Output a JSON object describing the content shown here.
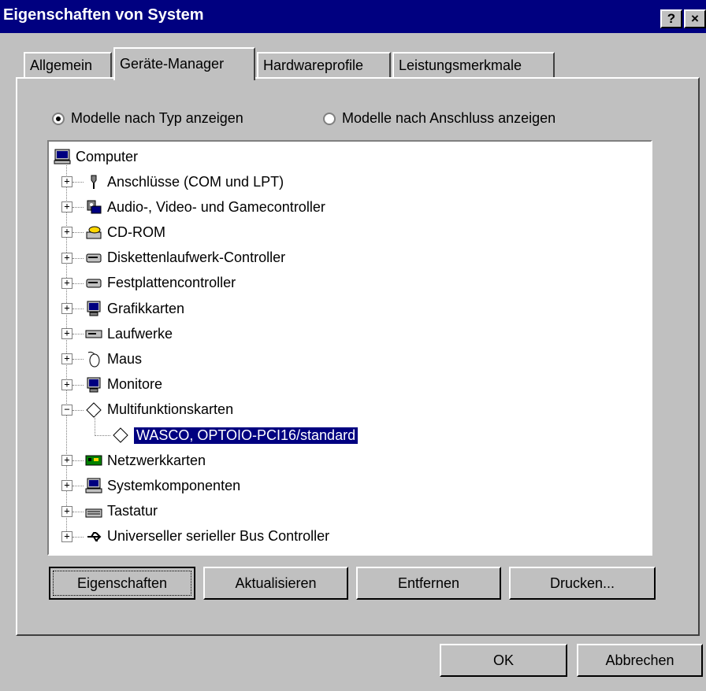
{
  "window": {
    "title": "Eigenschaften von System",
    "help_glyph": "?",
    "close_glyph": "×"
  },
  "tabs": [
    {
      "label": "Allgemein",
      "active": false
    },
    {
      "label": "Geräte-Manager",
      "active": true
    },
    {
      "label": "Hardwareprofile",
      "active": false
    },
    {
      "label": "Leistungsmerkmale",
      "active": false
    }
  ],
  "view_options": {
    "by_type": {
      "label": "Modelle nach Typ anzeigen",
      "selected": true
    },
    "by_connection": {
      "label": "Modelle nach Anschluss anzeigen",
      "selected": false
    }
  },
  "tree": {
    "root": {
      "label": "Computer",
      "icon": "computer-icon"
    },
    "items": [
      {
        "label": "Anschlüsse (COM und LPT)",
        "icon": "port-icon",
        "expanded": false
      },
      {
        "label": "Audio-, Video- und Gamecontroller",
        "icon": "audio-video-icon",
        "expanded": false
      },
      {
        "label": "CD-ROM",
        "icon": "cdrom-icon",
        "expanded": false
      },
      {
        "label": "Diskettenlaufwerk-Controller",
        "icon": "disk-controller-icon",
        "expanded": false
      },
      {
        "label": "Festplattencontroller",
        "icon": "harddisk-controller-icon",
        "expanded": false
      },
      {
        "label": "Grafikkarten",
        "icon": "display-adapter-icon",
        "expanded": false
      },
      {
        "label": "Laufwerke",
        "icon": "drive-icon",
        "expanded": false
      },
      {
        "label": "Maus",
        "icon": "mouse-icon",
        "expanded": false
      },
      {
        "label": "Monitore",
        "icon": "monitor-icon",
        "expanded": false
      },
      {
        "label": "Multifunktionskarten",
        "icon": "multifunction-card-icon",
        "expanded": true
      },
      {
        "label": "WASCO, OPTOIO-PCI16/standard",
        "icon": "multifunction-card-icon",
        "child": true,
        "selected": true
      },
      {
        "label": "Netzwerkkarten",
        "icon": "network-card-icon",
        "expanded": false
      },
      {
        "label": "Systemkomponenten",
        "icon": "system-devices-icon",
        "expanded": false
      },
      {
        "label": "Tastatur",
        "icon": "keyboard-icon",
        "expanded": false
      },
      {
        "label": "Universeller serieller Bus Controller",
        "icon": "usb-icon",
        "expanded": false
      }
    ]
  },
  "actions": {
    "properties": "Eigenschaften",
    "refresh": "Aktualisieren",
    "remove": "Entfernen",
    "print": "Drucken..."
  },
  "dialog": {
    "ok": "OK",
    "cancel": "Abbrechen"
  },
  "colors": {
    "face": "#c0c0c0",
    "titlebar": "#000080",
    "selection": "#000080"
  }
}
